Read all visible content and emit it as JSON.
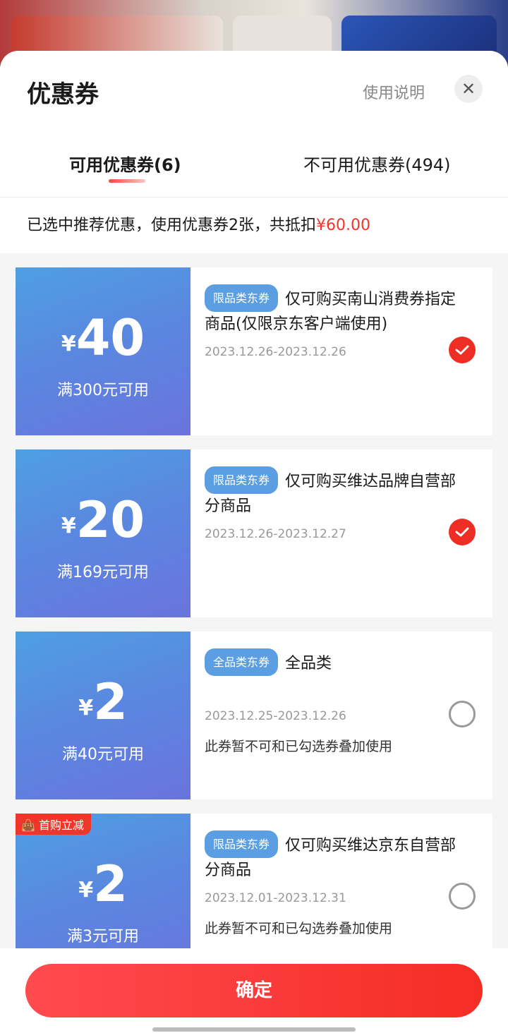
{
  "header": {
    "title": "优惠券",
    "help_label": "使用说明",
    "close_icon": "close-icon"
  },
  "tabs": [
    {
      "label": "可用优惠券(6)",
      "active": true
    },
    {
      "label": "不可用优惠券(494)",
      "active": false
    }
  ],
  "summary": {
    "text": "已选中推荐优惠，使用优惠券2张，共抵扣",
    "amount": "¥60.00"
  },
  "coupons": [
    {
      "currency": "¥",
      "amount": "40",
      "condition": "满300元可用",
      "tag": "限品类东券",
      "desc": "仅可购买南山消费券指定商品(仅限京东客户端使用)",
      "date": "2023.12.26-2023.12.26",
      "note": "",
      "selected": true,
      "badge": ""
    },
    {
      "currency": "¥",
      "amount": "20",
      "condition": "满169元可用",
      "tag": "限品类东券",
      "desc": "仅可购买维达品牌自营部分商品",
      "date": "2023.12.26-2023.12.27",
      "note": "",
      "selected": true,
      "badge": ""
    },
    {
      "currency": "¥",
      "amount": "2",
      "condition": "满40元可用",
      "tag": "全品类东券",
      "desc": "全品类",
      "date": "2023.12.25-2023.12.26",
      "note": "此券暂不可和已勾选券叠加使用",
      "selected": false,
      "badge": ""
    },
    {
      "currency": "¥",
      "amount": "2",
      "condition": "满3元可用",
      "tag": "限品类东券",
      "desc": "仅可购买维达京东自营部分商品",
      "date": "2023.12.01-2023.12.31",
      "note": "此券暂不可和已勾选券叠加使用",
      "selected": false,
      "badge": "首购立减"
    }
  ],
  "footer": {
    "confirm_label": "确定"
  },
  "colors": {
    "accent": "#f0352a",
    "coupon_blue": "#5b86e0"
  }
}
